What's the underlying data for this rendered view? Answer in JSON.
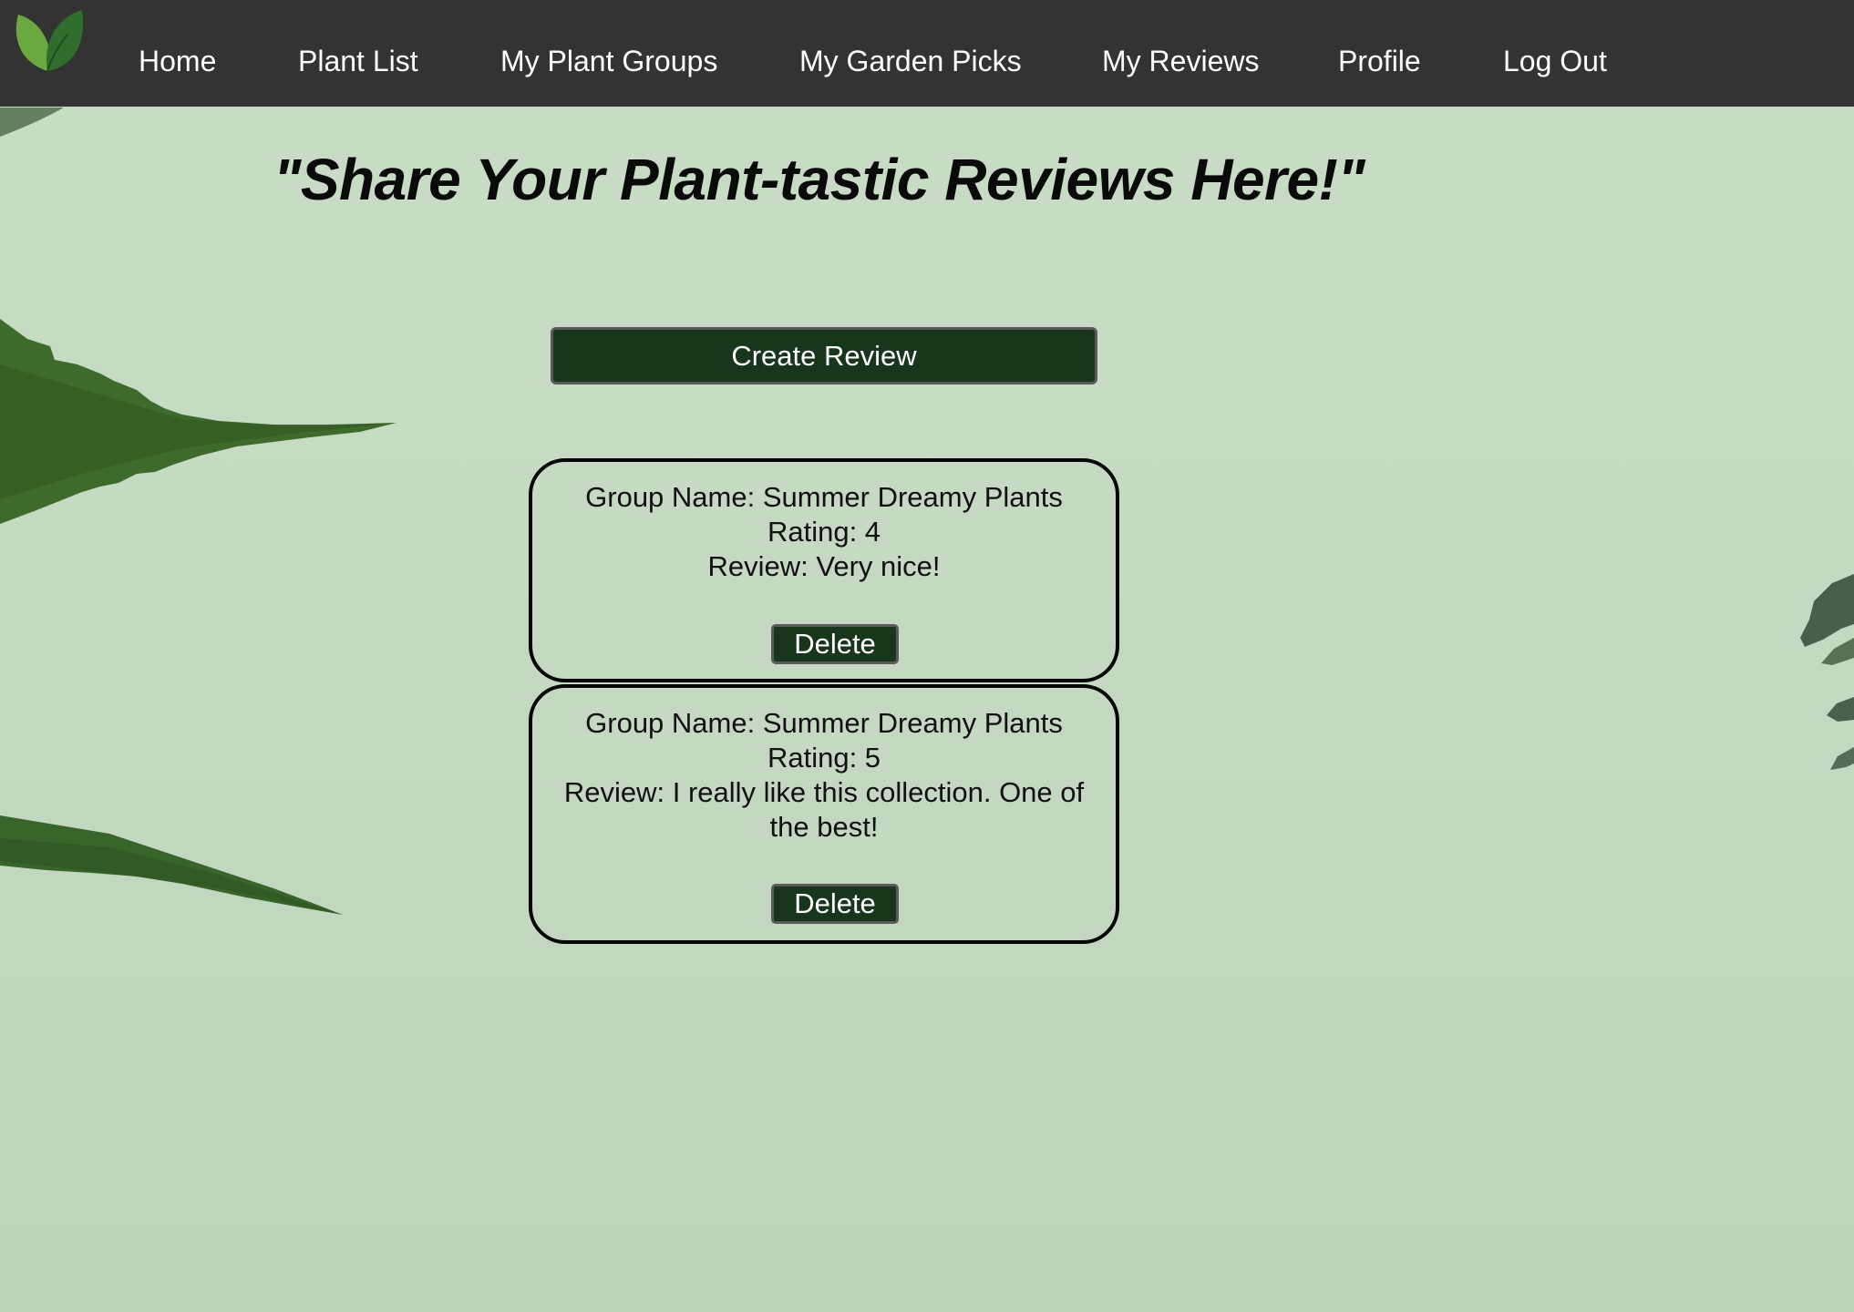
{
  "nav": {
    "links": [
      {
        "label": "Home"
      },
      {
        "label": "Plant List"
      },
      {
        "label": "My Plant Groups"
      },
      {
        "label": "My Garden Picks"
      },
      {
        "label": "My Reviews"
      },
      {
        "label": "Profile"
      },
      {
        "label": "Log Out"
      }
    ],
    "logo_icon": "leaf-logo-icon"
  },
  "main": {
    "title": "\"Share Your Plant-tastic Reviews Here!\"",
    "create_button_label": "Create Review"
  },
  "reviews": [
    {
      "group_line": "Group Name: Summer Dreamy Plants",
      "rating_line": "Rating: 4",
      "review_line": "Review: Very nice!",
      "delete_label": "Delete"
    },
    {
      "group_line": "Group Name: Summer Dreamy Plants",
      "rating_line": "Rating: 5",
      "review_line": "Review: I really like this collection. One of the best!",
      "delete_label": "Delete"
    }
  ],
  "colors": {
    "navbar": "#333333",
    "button_green": "#17361b",
    "background_green": "#c9dcc6",
    "leaf_dark": "#2d5a26",
    "leaf_light": "#5e9a3a"
  }
}
